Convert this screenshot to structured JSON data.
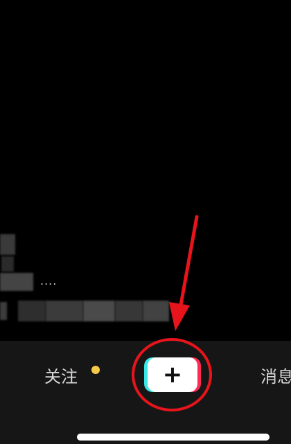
{
  "caption": {
    "ellipsis": "...."
  },
  "tabbar": {
    "follow_label": "关注",
    "create_symbol": "+",
    "messages_label": "消息"
  },
  "colors": {
    "background": "#000000",
    "tabbar_background": "#161616",
    "notification_dot": "#f7c948",
    "create_cyan": "#38e6e6",
    "create_red": "#fe2c55",
    "annotation_red": "#e8141c"
  },
  "icons": {
    "notification": "yellow-dot",
    "create": "plus-icon"
  },
  "annotation": {
    "shapes": [
      "red-circle",
      "red-arrow"
    ]
  }
}
